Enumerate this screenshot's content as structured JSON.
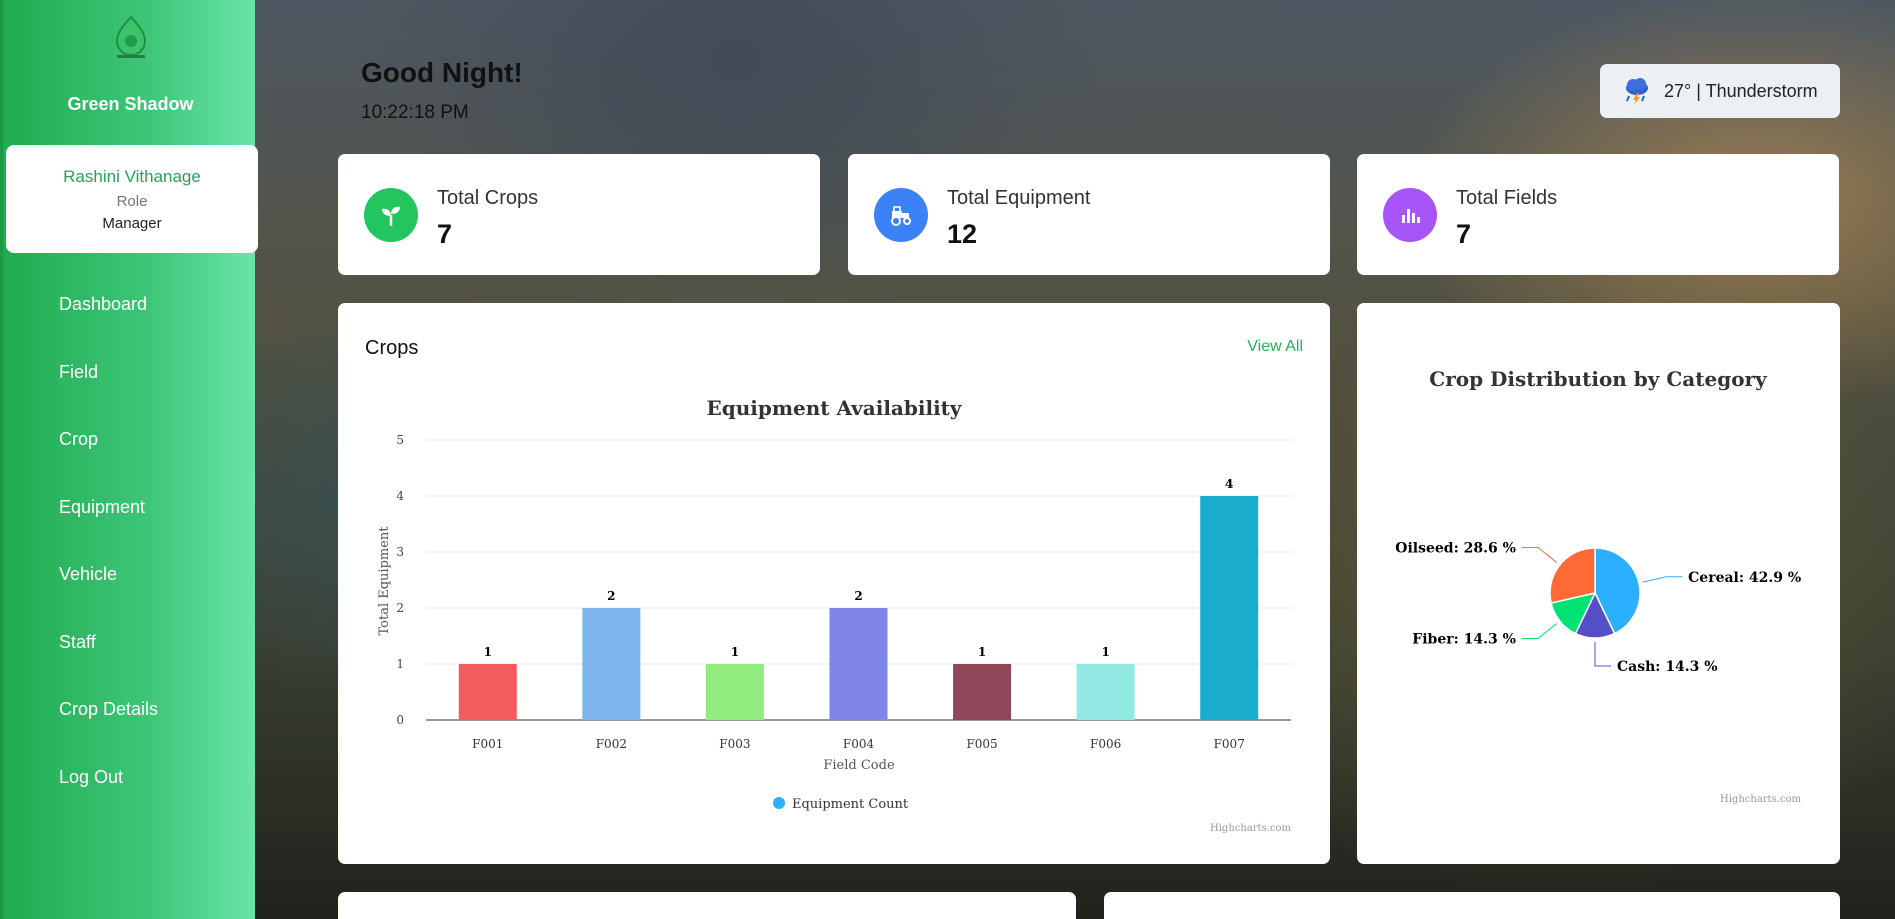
{
  "sidebar": {
    "brand": "Green Shadow",
    "user": {
      "name": "Rashini Vithanage",
      "role_label": "Role",
      "role": "Manager"
    },
    "items": [
      {
        "label": "Dashboard"
      },
      {
        "label": "Field"
      },
      {
        "label": "Crop"
      },
      {
        "label": "Equipment"
      },
      {
        "label": "Vehicle"
      },
      {
        "label": "Staff"
      },
      {
        "label": "Crop Details"
      },
      {
        "label": "Log Out"
      }
    ]
  },
  "header": {
    "greeting": "Good Night!",
    "time": "10:22:18 PM",
    "weather": "27° | Thunderstorm",
    "weather_icon": "thunderstorm-icon"
  },
  "stats": [
    {
      "label": "Total Crops",
      "value": "7",
      "icon": "sprout-icon",
      "color": "#22c55e"
    },
    {
      "label": "Total Equipment",
      "value": "12",
      "icon": "tractor-icon",
      "color": "#3b82f6"
    },
    {
      "label": "Total Fields",
      "value": "7",
      "icon": "bar-chart-icon",
      "color": "#a855f7"
    }
  ],
  "crops_panel": {
    "title": "Crops",
    "view_all": "View All",
    "credit": "Highcharts.com"
  },
  "pie_panel": {
    "credit": "Highcharts.com"
  },
  "chart_data": [
    {
      "type": "bar",
      "title": "Equipment Availability",
      "xlabel": "Field Code",
      "ylabel": "Total Equipment",
      "categories": [
        "F001",
        "F002",
        "F003",
        "F004",
        "F005",
        "F006",
        "F007"
      ],
      "series": [
        {
          "name": "Equipment Count",
          "values": [
            1,
            2,
            1,
            2,
            1,
            1,
            4
          ]
        }
      ],
      "colors": [
        "#f15c5f",
        "#7cb5ec",
        "#90ed7d",
        "#8085e9",
        "#91475a",
        "#92e8e2",
        "#1aadce"
      ],
      "legend_color": "#2caffe",
      "ylim": [
        0,
        5
      ],
      "yticks": [
        0,
        1,
        2,
        3,
        4,
        5
      ],
      "grid": true,
      "legend": "bottom-center",
      "data_labels": true
    },
    {
      "type": "pie",
      "title": "Crop Distribution by Category",
      "slices": [
        {
          "label": "Cereal",
          "value": 42.9,
          "color": "#2caffe"
        },
        {
          "label": "Cash",
          "value": 14.3,
          "color": "#544fc5"
        },
        {
          "label": "Fiber",
          "value": 14.3,
          "color": "#00e272"
        },
        {
          "label": "Oilseed",
          "value": 28.6,
          "color": "#fe6a35"
        }
      ],
      "label_format": "{label}: {value} %"
    }
  ]
}
